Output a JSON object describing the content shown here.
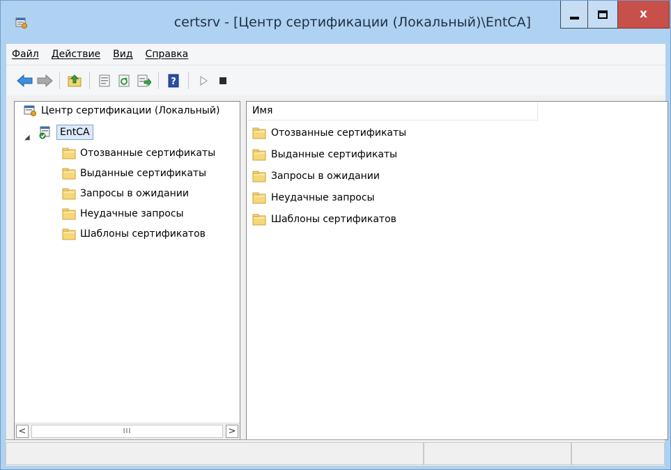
{
  "window": {
    "title": "certsrv - [Центр сертификации (Локальный)\\EntCA]",
    "close_glyph": "x",
    "colors": {
      "frame": "#afd2f2",
      "close": "#c7504b",
      "selection": "#dce9f8"
    }
  },
  "menu": {
    "items": [
      {
        "label": "Файл"
      },
      {
        "label": "Действие"
      },
      {
        "label": "Вид"
      },
      {
        "label": "Справка"
      }
    ]
  },
  "toolbar": {
    "icons": [
      "back-arrow-icon",
      "forward-arrow-icon",
      "up-folder-icon",
      "properties-icon",
      "refresh-icon",
      "export-list-icon",
      "help-icon",
      "start-service-icon",
      "stop-service-icon"
    ]
  },
  "tree": {
    "root_label": "Центр сертификации (Локальный)",
    "expander_glyph": "◢",
    "ca_label": "EntCA",
    "children": [
      {
        "label": "Отозванные сертификаты"
      },
      {
        "label": "Выданные сертификаты"
      },
      {
        "label": "Запросы в ожидании"
      },
      {
        "label": "Неудачные запросы"
      },
      {
        "label": "Шаблоны сертификатов"
      }
    ],
    "scroll_left": "<",
    "scroll_right": ">",
    "scroll_thumb": "III"
  },
  "list": {
    "column_name": "Имя",
    "items": [
      {
        "label": "Отозванные сертификаты"
      },
      {
        "label": "Выданные сертификаты"
      },
      {
        "label": "Запросы в ожидании"
      },
      {
        "label": "Неудачные запросы"
      },
      {
        "label": "Шаблоны сертификатов"
      }
    ]
  }
}
